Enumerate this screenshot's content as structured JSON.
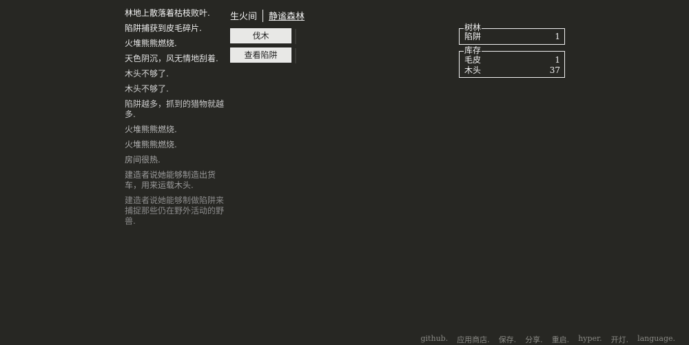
{
  "notifications": [
    {
      "text": "林地上散落着枯枝败叶.",
      "color": "#f2f2f2"
    },
    {
      "text": "陷阱捕获到皮毛碎片.",
      "color": "#eeeeee"
    },
    {
      "text": "火堆熊熊燃烧.",
      "color": "#e8e8e8"
    },
    {
      "text": "天色阴沉，风无情地刮着.",
      "color": "#e0e0e0"
    },
    {
      "text": "木头不够了.",
      "color": "#d8d8d8"
    },
    {
      "text": "木头不够了.",
      "color": "#d2d2d2"
    },
    {
      "text": "陷阱越多，抓到的猎物就越多.",
      "color": "#c8c8c8"
    },
    {
      "text": "火堆熊熊燃烧.",
      "color": "#bdbdbd"
    },
    {
      "text": "火堆熊熊燃烧.",
      "color": "#b2b2b2"
    },
    {
      "text": "房间很热.",
      "color": "#a6a6a6"
    },
    {
      "text": "建造者说她能够制造出货车，用来运载木头.",
      "color": "#999999"
    },
    {
      "text": "建造者说她能够制做陷阱来捕捉那些仍在野外活动的野兽.",
      "color": "#8c8c8c"
    }
  ],
  "header": {
    "tabs": [
      {
        "label": "生火间",
        "selected": false
      },
      {
        "label": "静谧森林",
        "selected": true
      }
    ]
  },
  "actions": {
    "gather_wood": "伐木",
    "check_traps": "查看陷阱"
  },
  "stores": {
    "trees": {
      "legend": "树林",
      "rows": [
        {
          "name": "陷阱",
          "value": "1"
        }
      ]
    },
    "inventory": {
      "legend": "库存",
      "rows": [
        {
          "name": "毛皮",
          "value": "1"
        },
        {
          "name": "木头",
          "value": "37"
        }
      ]
    }
  },
  "footer": {
    "links": [
      "github.",
      "应用商店.",
      "保存.",
      "分享.",
      "重启.",
      "hyper.",
      "开灯.",
      "language."
    ]
  }
}
